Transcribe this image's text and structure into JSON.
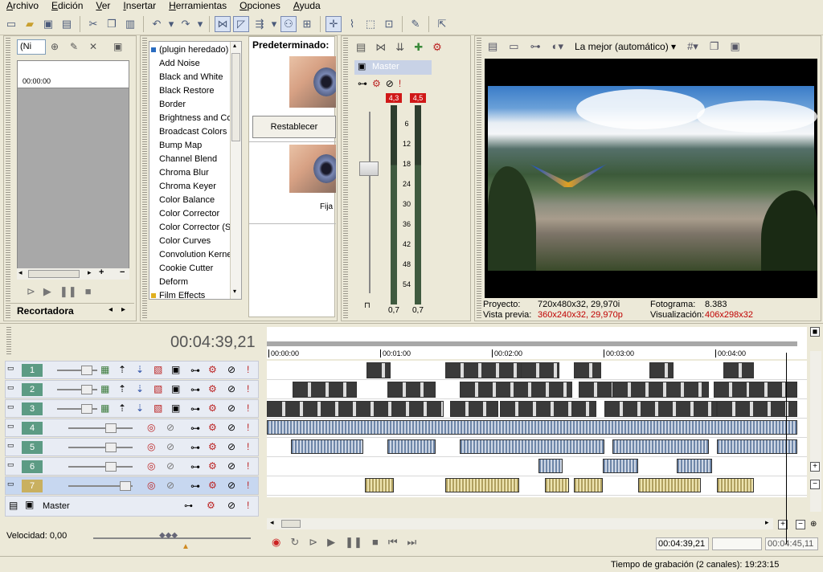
{
  "menu": [
    "Archivo",
    "Edición",
    "Ver",
    "Insertar",
    "Herramientas",
    "Opciones",
    "Ayuda"
  ],
  "trimmer": {
    "select_value": "(Ni",
    "time": "00:00:00",
    "tab_label": "Recortadora"
  },
  "fx_list": {
    "items": [
      "(plugin heredado)",
      "Add Noise",
      "Black and White",
      "Black Restore",
      "Border",
      "Brightness and Co",
      "Broadcast Colors",
      "Bump Map",
      "Channel Blend",
      "Chroma Blur",
      "Chroma Keyer",
      "Color Balance",
      "Color Corrector",
      "Color Corrector (S",
      "Color Curves",
      "Convolution Kerne",
      "Cookie Cutter",
      "Deform",
      "Film Effects"
    ]
  },
  "preset": {
    "header": "Predeterminado:",
    "reset_label": "Restablecer",
    "fija_label": "Fija"
  },
  "mixer": {
    "label": "Master",
    "peak_left": "4,3",
    "peak_right": "4,5",
    "scale": [
      "6",
      "12",
      "18",
      "24",
      "30",
      "36",
      "42",
      "48",
      "54"
    ],
    "gain_left": "0,7",
    "gain_right": "0,7",
    "colors": {
      "peak": "#d01818"
    }
  },
  "preview": {
    "quality": "La mejor (automático)",
    "project_label": "Proyecto:",
    "project_value": "720x480x32, 29,970i",
    "preview_label": "Vista previa:",
    "preview_value": "360x240x32, 29,970p",
    "frame_label": "Fotograma:",
    "frame_value": "8.383",
    "display_label": "Visualización:",
    "display_value": "406x298x32",
    "colors": {
      "highlight": "#c00000"
    }
  },
  "timeline": {
    "time": "00:04:39,21",
    "ruler": [
      "00:00:00",
      "00:01:00",
      "00:02:00",
      "00:03:00",
      "00:04:00"
    ],
    "tracks": [
      "1",
      "2",
      "3",
      "4",
      "5",
      "6",
      "7"
    ],
    "master_label": "Master"
  },
  "transport": {
    "speed_label": "Velocidad: 0,00",
    "current": "00:04:39,21",
    "end": "00:04:45,11"
  },
  "status": {
    "recording": "Tiempo de grabación (2 canales): 19:23:15"
  }
}
